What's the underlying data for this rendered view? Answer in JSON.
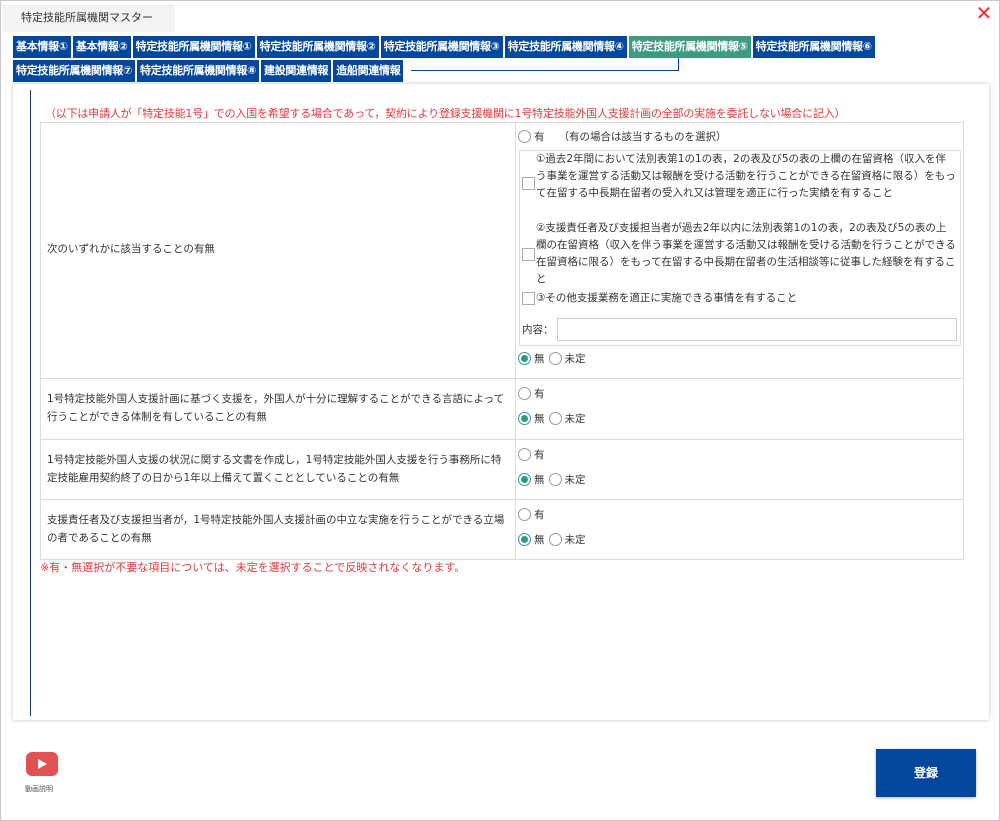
{
  "window": {
    "title": "特定技能所属機関マスター",
    "close_label": "✕"
  },
  "tabs": {
    "row1": [
      "基本情報①",
      "基本情報②",
      "特定技能所属機関情報①",
      "特定技能所属機関情報②",
      "特定技能所属機関情報③",
      "特定技能所属機関情報④",
      "特定技能所属機関情報⑤",
      "特定技能所属機関情報⑥"
    ],
    "row2": [
      "特定技能所属機関情報⑦",
      "特定技能所属機関情報⑧",
      "建設関連情報",
      "造船関連情報"
    ],
    "active": "特定技能所属機関情報⑤"
  },
  "notice": "（以下は申請人が「特定技能1号」での入国を希望する場合であって，契約により登録支援機関に1号特定技能外国人支援計画の全部の実施を委託しない場合に記入）",
  "questions": [
    {
      "label": "次のいずれかに該当することの有無",
      "yes_label": "有",
      "yes_hint": "（有の場合は該当するものを選択）",
      "options": [
        "①過去2年間において法別表第1の1の表，2の表及び5の表の上欄の在留資格（収入を伴う事業を運営する活動又は報酬を受ける活動を行うことができる在留資格に限る）をもって在留する中長期在留者の受入れ又は管理を適正に行った実績を有すること",
        "②支援責任者及び支援担当者が過去2年以内に法別表第1の1の表，2の表及び5の表の上欄の在留資格（収入を伴う事業を運営する活動又は報酬を受ける活動を行うことができる在留資格に限る）をもって在留する中長期在留者の生活相談等に従事した経験を有すること",
        "③その他支援業務を適正に実施できる事情を有すること"
      ],
      "content_label": "内容：",
      "content_value": "",
      "no_label": "無",
      "undecided_label": "未定",
      "selected": "無"
    },
    {
      "label": "1号特定技能外国人支援計画に基づく支援を，外国人が十分に理解することができる言語によって行うことができる体制を有していることの有無",
      "yes_label": "有",
      "no_label": "無",
      "undecided_label": "未定",
      "selected": "無"
    },
    {
      "label": "1号特定技能外国人支援の状況に関する文書を作成し，1号特定技能外国人支援を行う事務所に特定技能雇用契約終了の日から1年以上備えて置くこととしていることの有無",
      "yes_label": "有",
      "no_label": "無",
      "undecided_label": "未定",
      "selected": "無"
    },
    {
      "label": "支援責任者及び支援担当者が，1号特定技能外国人支援計画の中立な実施を行うことができる立場の者であることの有無",
      "yes_label": "有",
      "no_label": "無",
      "undecided_label": "未定",
      "selected": "無"
    }
  ],
  "bottom_note": "※有・無選択が不要な項目については、未定を選択することで反映されなくなります。",
  "footer": {
    "video_label": "動画説明",
    "register_label": "登録"
  }
}
